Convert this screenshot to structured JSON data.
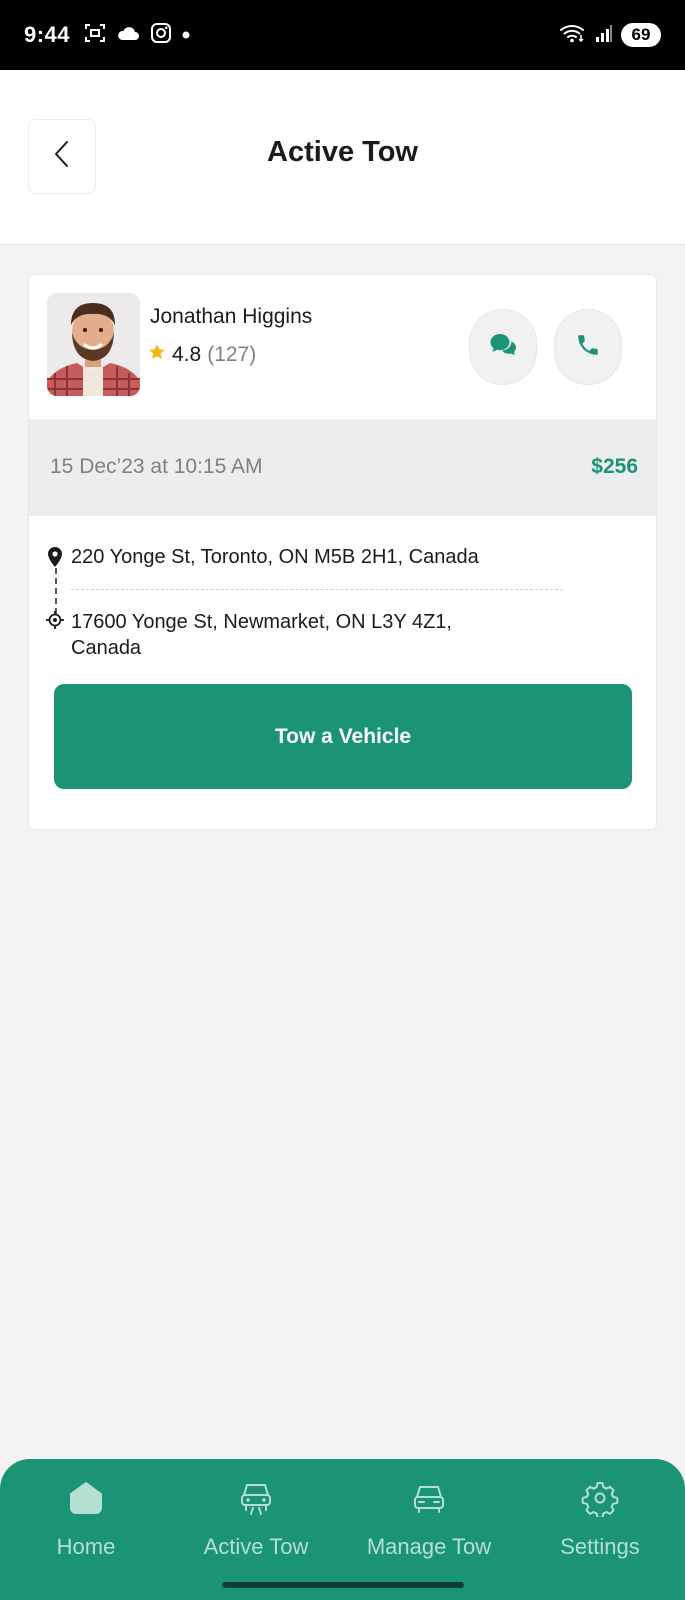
{
  "status_bar": {
    "time": "9:44",
    "battery": "69"
  },
  "header": {
    "title": "Active Tow"
  },
  "driver": {
    "name": "Jonathan Higgins",
    "rating": "4.8",
    "reviews": "(127)"
  },
  "trip": {
    "datetime": "15 Dec’23 at 10:15 AM",
    "price": "$256",
    "pickup": "220 Yonge St, Toronto, ON M5B 2H1, Canada",
    "dropoff": "17600 Yonge St, Newmarket, ON L3Y 4Z1, Canada",
    "action_label": "Tow a Vehicle"
  },
  "nav": {
    "items": [
      {
        "label": "Home",
        "icon": "home-icon"
      },
      {
        "label": "Active Tow",
        "icon": "car-front-icon"
      },
      {
        "label": "Manage Tow",
        "icon": "car-icon"
      },
      {
        "label": "Settings",
        "icon": "gear-icon"
      }
    ]
  },
  "colors": {
    "accent": "#1a9474",
    "nav_text": "#b4e0d3",
    "star": "#f5b50a"
  }
}
